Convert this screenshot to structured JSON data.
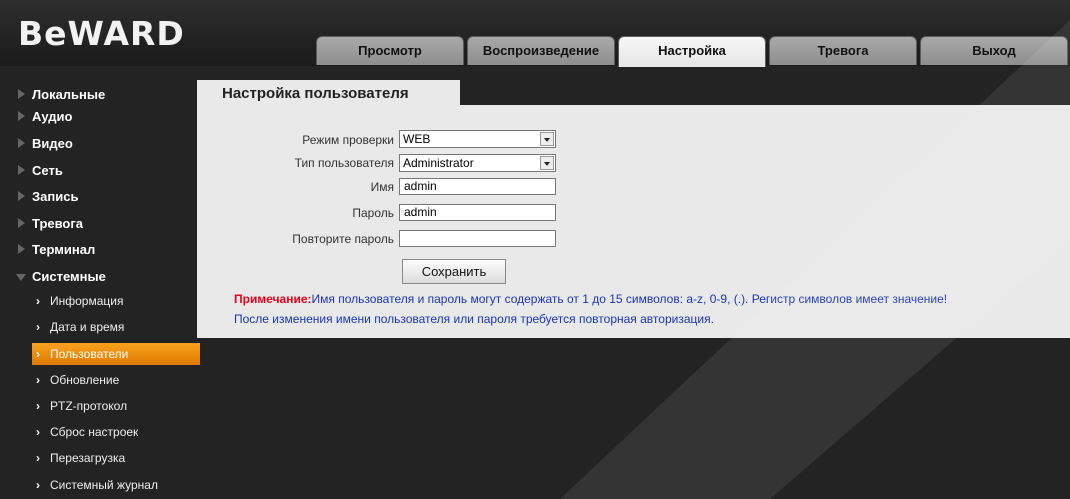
{
  "brand": {
    "logo": "BeWARD"
  },
  "tabs": [
    {
      "label": "Просмотр",
      "active": false
    },
    {
      "label": "Воспроизведение",
      "active": false
    },
    {
      "label": "Настройка",
      "active": true
    },
    {
      "label": "Тревога",
      "active": false
    },
    {
      "label": "Выход",
      "active": false
    }
  ],
  "sidebar": {
    "sections": [
      "Локальные",
      "Аудио",
      "Видео",
      "Сеть",
      "Запись",
      "Тревога",
      "Терминал",
      "Системные"
    ],
    "sub_items": [
      "Информация",
      "Дата и время",
      "Пользователи",
      "Обновление",
      "PTZ-протокол",
      "Сброс настроек",
      "Перезагрузка",
      "Системный журнал"
    ],
    "active_sub": "Пользователи"
  },
  "page": {
    "title": "Настройка пользователя",
    "fields": {
      "auth_mode": {
        "label": "Режим проверки",
        "value": "WEB"
      },
      "user_type": {
        "label": "Тип пользователя",
        "value": "Administrator"
      },
      "name": {
        "label": "Имя",
        "value": "admin"
      },
      "password": {
        "label": "Пароль",
        "value": "admin"
      },
      "password_repeat": {
        "label": "Повторите пароль",
        "value": ""
      }
    },
    "save_label": "Сохранить",
    "note_prefix": "Примечание:",
    "note_line1": "Имя пользователя и пароль могут содержать от 1 до 15 символов: a-z, 0-9, (.). Регистр символов имеет значение!",
    "note_line2": "После изменения имени пользователя или пароля требуется повторная авторизация."
  },
  "colors": {
    "active_sub_bg": "#f39200",
    "note_red": "#e8001c",
    "note_blue": "#1b35b8",
    "panel_bg": "#e9e9e9",
    "page_bg": "#232323"
  }
}
